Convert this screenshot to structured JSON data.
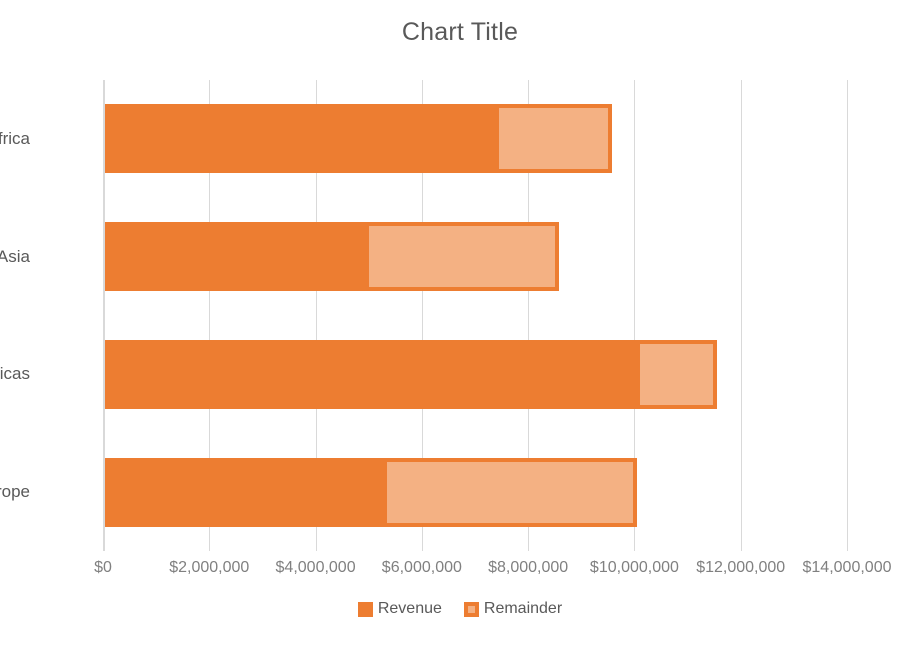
{
  "chart_data": {
    "type": "bar",
    "orientation": "horizontal",
    "stacked": true,
    "title": "Chart Title",
    "xlabel": "",
    "ylabel": "",
    "categories": [
      "Africa",
      "Asia",
      "Americas",
      "Europe"
    ],
    "series": [
      {
        "name": "Revenue",
        "color": "#ED7D31",
        "values": [
          7380000,
          4930000,
          10030000,
          5270000
        ]
      },
      {
        "name": "Remainder",
        "color": "#F4B183",
        "border_color": "#ED7D31",
        "values": [
          2200000,
          3650000,
          1520000,
          4780000
        ]
      }
    ],
    "xlim": [
      0,
      14000000
    ],
    "xticks": [
      0,
      2000000,
      4000000,
      6000000,
      8000000,
      10000000,
      12000000,
      14000000
    ],
    "xtick_labels": [
      "$0",
      "$2,000,000",
      "$4,000,000",
      "$6,000,000",
      "$8,000,000",
      "$10,000,000",
      "$12,000,000",
      "$14,000,000"
    ],
    "grid": "vertical",
    "legend_position": "bottom",
    "background": "#FFFFFF",
    "text_color": "#595959",
    "gridline_color": "#D9D9D9"
  },
  "legend": {
    "items": [
      {
        "label": "Revenue",
        "style": "solid"
      },
      {
        "label": "Remainder",
        "style": "outlined"
      }
    ]
  }
}
